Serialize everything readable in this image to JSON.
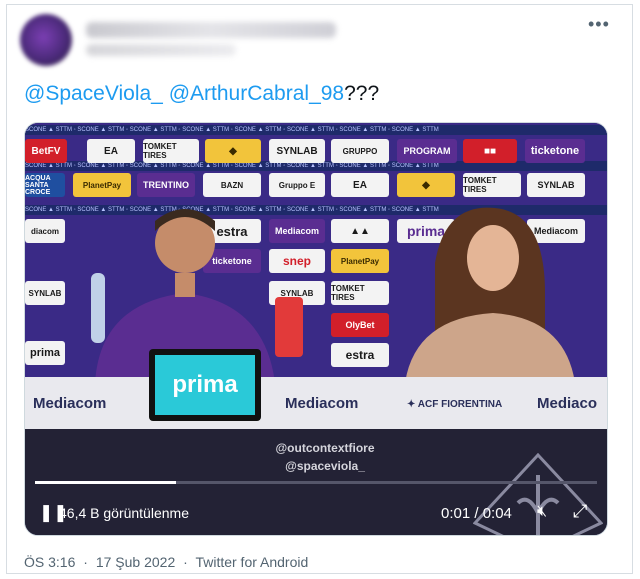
{
  "tweet": {
    "text_prefix": "@SpaceViola_ @ArthurCabral_98",
    "mention_1": "@SpaceViola_",
    "mention_2": "@ArthurCabral_98",
    "suffix": "???"
  },
  "icons": {
    "more": "more-icon",
    "play_pause": "pause-icon",
    "mute": "mute-icon",
    "fullscreen": "expand-icon"
  },
  "video": {
    "views": "46,4 B görüntülenme",
    "time": "0:01 / 0:04",
    "progress": 0.25,
    "watermark_1": "@outcontextfiore",
    "watermark_2": "@spaceviola_",
    "sponsors": {
      "betfv": "BetFV",
      "tommkin": "TOMKET TIRES",
      "synlab": "SYNLAB",
      "gruppo": "GRUPPO",
      "program": "PROGRAM",
      "ticketone": "ticketone",
      "acqua": "ACQUA SANTA CROCE",
      "planetpay": "PlanetPay",
      "trentino": "TRENTINO",
      "mediacom": "Mediacom",
      "estra": "estra",
      "prima": "prima",
      "snep": "snep",
      "olybet": "OlyBet"
    },
    "table_left": "Mediacom",
    "table_center": "Mediacom",
    "table_acf": "ACF FIORENTINA",
    "table_right": "Mediaco",
    "screen_brand": "prima"
  },
  "footer": {
    "time": "ÖS 3:16",
    "date": "17 Şub 2022",
    "source": "Twitter for Android",
    "separator": "·"
  }
}
